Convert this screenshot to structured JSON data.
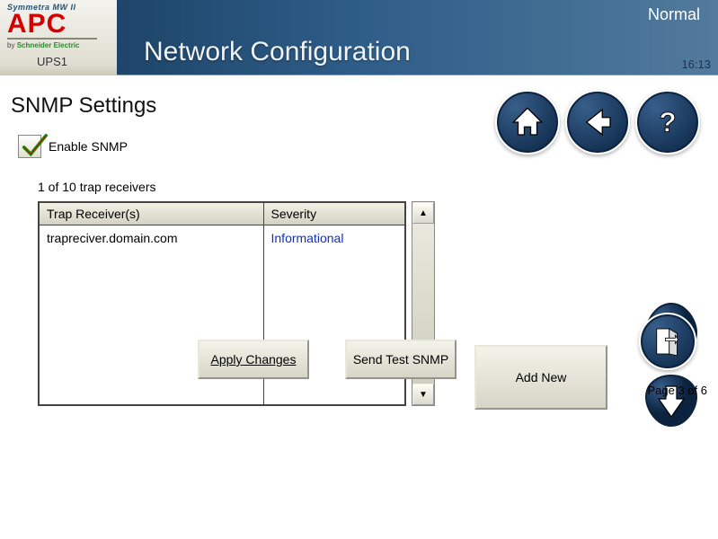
{
  "header": {
    "product_line": "Symmetra MW II",
    "brand": "APC",
    "by_line_prefix": "by",
    "by_line_brand": "Schneider Electric",
    "device": "UPS1",
    "status": "Normal",
    "title": "Network Configuration",
    "time": "16:13"
  },
  "page": {
    "section_title": "SNMP Settings",
    "enable_label": "Enable SNMP",
    "enabled": true,
    "count_text": "1 of 10 trap receivers",
    "columns": {
      "receiver": "Trap Receiver(s)",
      "severity": "Severity"
    },
    "rows": [
      {
        "receiver": "trapreciver.domain.com",
        "severity": "Informational"
      }
    ],
    "buttons": {
      "add_new": "Add New",
      "apply": "Apply Changes",
      "send_test": "Send Test SNMP"
    },
    "page_indicator": "Page 3 of 6"
  }
}
